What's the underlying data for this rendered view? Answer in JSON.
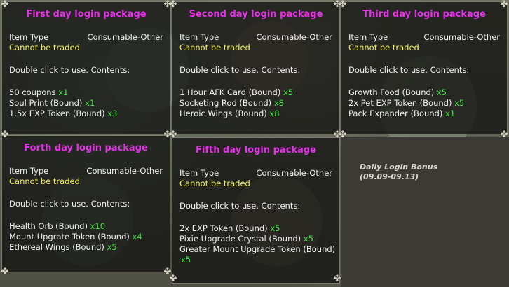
{
  "tooltips": [
    {
      "title": "First day login package",
      "item_type_label": "Item Type",
      "item_type_value": "Consumable-Other",
      "trade_note": "Cannot be traded",
      "use_note": "Double click to use. Contents:",
      "items": [
        {
          "name": "50 coupons",
          "qty": "x1"
        },
        {
          "name": "Soul Print (Bound)",
          "qty": "x1"
        },
        {
          "name": "1.5x EXP Token (Bound)",
          "qty": "x3"
        }
      ]
    },
    {
      "title": "Second day login package",
      "item_type_label": "Item Type",
      "item_type_value": "Consumable-Other",
      "trade_note": "Cannot be traded",
      "use_note": "Double click to use. Contents:",
      "items": [
        {
          "name": "1 Hour AFK Card (Bound)",
          "qty": "x5"
        },
        {
          "name": "Socketing Rod (Bound)",
          "qty": "x8"
        },
        {
          "name": "Heroic Wings (Bound)",
          "qty": "x8"
        }
      ]
    },
    {
      "title": "Third day login package",
      "item_type_label": "Item Type",
      "item_type_value": "Consumable-Other",
      "trade_note": "Cannot be traded",
      "use_note": "Double click to use. Contents:",
      "items": [
        {
          "name": "Growth Food (Bound)",
          "qty": "x5"
        },
        {
          "name": "2x Pet EXP Token (Bound)",
          "qty": "x5"
        },
        {
          "name": "Pack Expander (Bound)",
          "qty": "x1"
        }
      ]
    },
    {
      "title": "Forth day login package",
      "item_type_label": "Item Type",
      "item_type_value": "Consumable-Other",
      "trade_note": "Cannot be traded",
      "use_note": "Double click to use. Contents:",
      "items": [
        {
          "name": "Health Orb (Bound)",
          "qty": "x10"
        },
        {
          "name": "Mount Upgrate Token (Bound)",
          "qty": "x4"
        },
        {
          "name": "Ethereal Wings (Bound)",
          "qty": "x5"
        }
      ]
    },
    {
      "title": "Fifth day login package",
      "item_type_label": "Item Type",
      "item_type_value": "Consumable-Other",
      "trade_note": "Cannot be traded",
      "use_note": "Double click to use. Contents:",
      "items": [
        {
          "name": "2x EXP Token (Bound)",
          "qty": "x5"
        },
        {
          "name": "Pixie Upgrade Crystal (Bound)",
          "qty": "x5"
        },
        {
          "name": "Greater Mount Upgrade Token (Bound)",
          "qty": "x5"
        }
      ]
    }
  ],
  "bonus": {
    "title": "Daily Login Bonus",
    "dates": "(09.09-09.13)"
  },
  "colors": {
    "title": "#e233e6",
    "untradeable": "#f2f05a",
    "quantity": "#3fe33f"
  }
}
